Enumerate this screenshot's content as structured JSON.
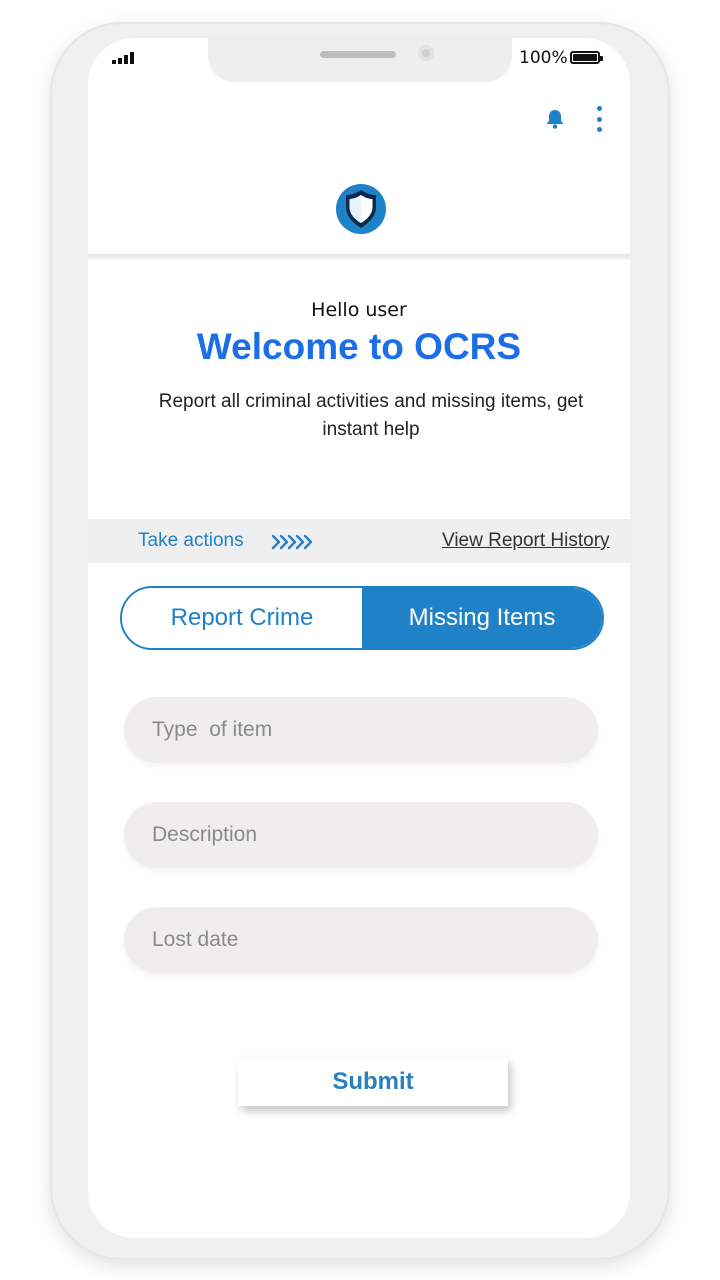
{
  "status_bar": {
    "battery_percent": "100%",
    "signal_icon": "signal-bars-icon",
    "battery_icon": "battery-full-icon"
  },
  "top_bar": {
    "notification_icon": "bell-icon",
    "menu_icon": "kebab-menu-icon",
    "logo_icon": "shield-icon",
    "accent_color": "#1f82c8"
  },
  "hero": {
    "greeting": "Hello user",
    "title": "Welcome to OCRS",
    "subtitle": "Report all criminal activities and missing items, get instant help",
    "title_color": "#1a6fe8"
  },
  "actions_bar": {
    "take_actions_label": "Take actions",
    "chevrons_icon": "double-chevron-right-icon",
    "view_history_label": "View Report History"
  },
  "tabs": [
    {
      "label": "Report Crime",
      "selected": false
    },
    {
      "label": "Missing Items",
      "selected": true
    }
  ],
  "form": {
    "type_of_item": {
      "value": "",
      "placeholder": "Type  of item"
    },
    "description": {
      "value": "",
      "placeholder": "Description"
    },
    "lost_date": {
      "value": "",
      "placeholder": "Lost date"
    },
    "submit_label": "Submit"
  }
}
